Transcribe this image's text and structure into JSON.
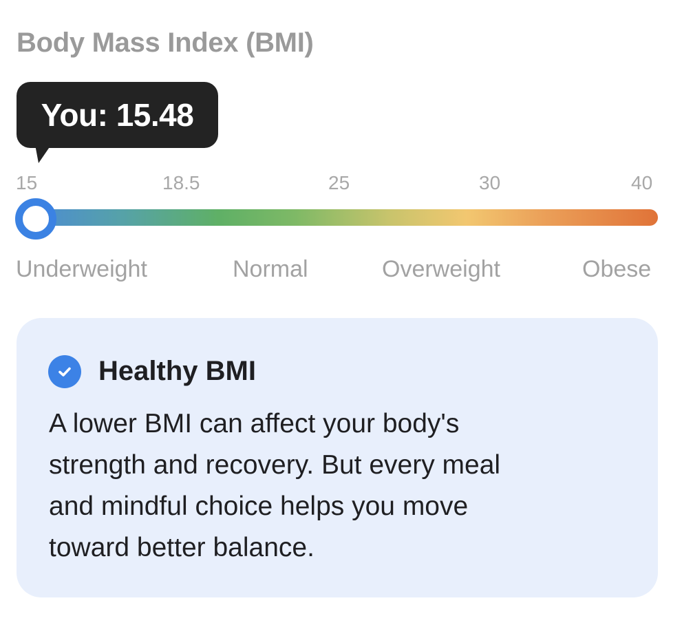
{
  "title": "Body Mass Index (BMI)",
  "tooltip": {
    "text": "You: 15.48"
  },
  "scale": {
    "ticks": [
      "15",
      "18.5",
      "25",
      "30",
      "40"
    ],
    "categories": [
      "Underweight",
      "Normal",
      "Overweight",
      "Obese"
    ],
    "value": 15.48,
    "min": 15,
    "max": 40,
    "gradient_colors": [
      "#4b89d8",
      "#5fb066",
      "#f2c770",
      "#e07338"
    ],
    "thumb_color": "#3b82e3"
  },
  "card": {
    "icon": "check-circle-icon",
    "heading": "Healthy BMI",
    "body_lines": [
      "A lower BMI can affect your body's",
      "strength and recovery. But every meal",
      "and mindful choice helps you move",
      "toward better balance."
    ],
    "background": "#e8effc",
    "accent": "#3c82e6"
  }
}
